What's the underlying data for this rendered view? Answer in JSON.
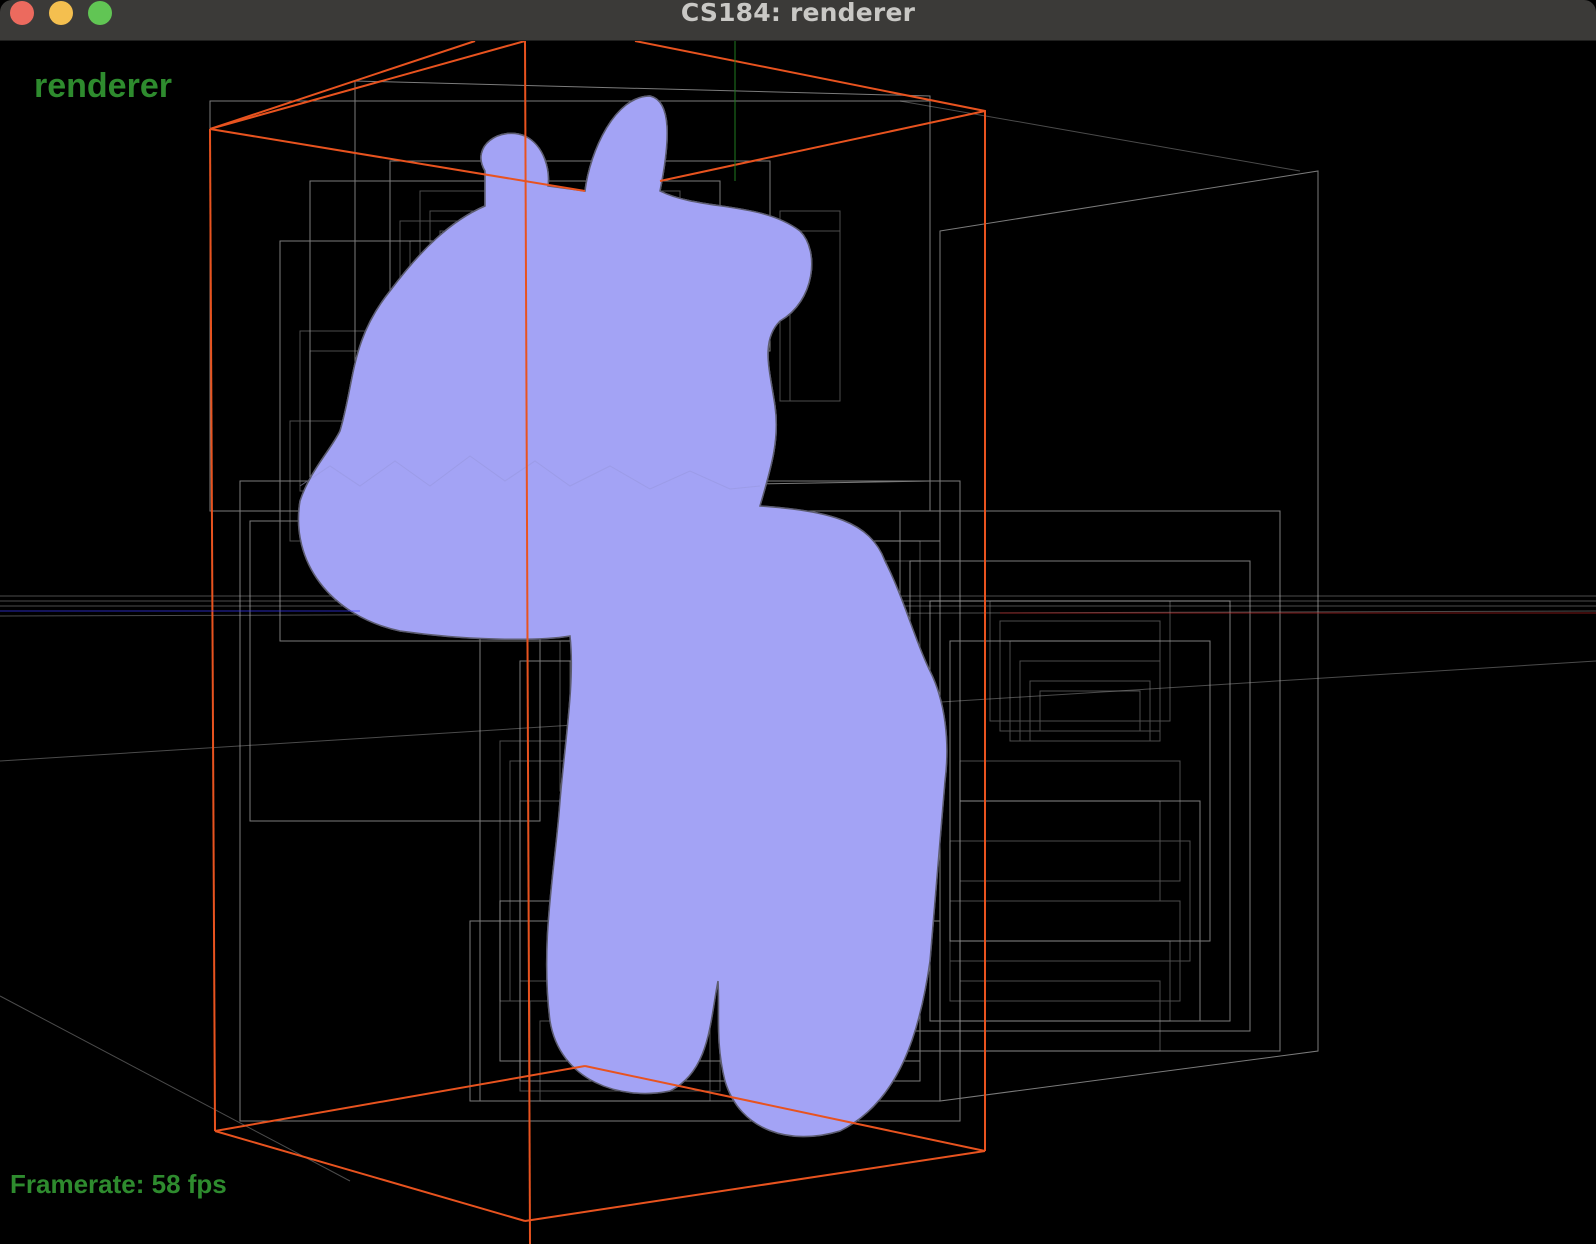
{
  "window": {
    "title": "CS184: renderer"
  },
  "controls": {
    "close": "close-button",
    "minimize": "minimize-button",
    "zoom": "zoom-button"
  },
  "overlay": {
    "app_label": "renderer",
    "framerate_label": "Framerate: 58 fps"
  },
  "colors": {
    "background": "#000000",
    "bbox_selected": "#e8531f",
    "bbox_node": "#bdbdbd",
    "mesh_upper": "#d2d2fb",
    "mesh_lower": "#a3a3f5",
    "mesh_wire": "#7f7f8a",
    "overlay_text": "#2e8b2e"
  }
}
